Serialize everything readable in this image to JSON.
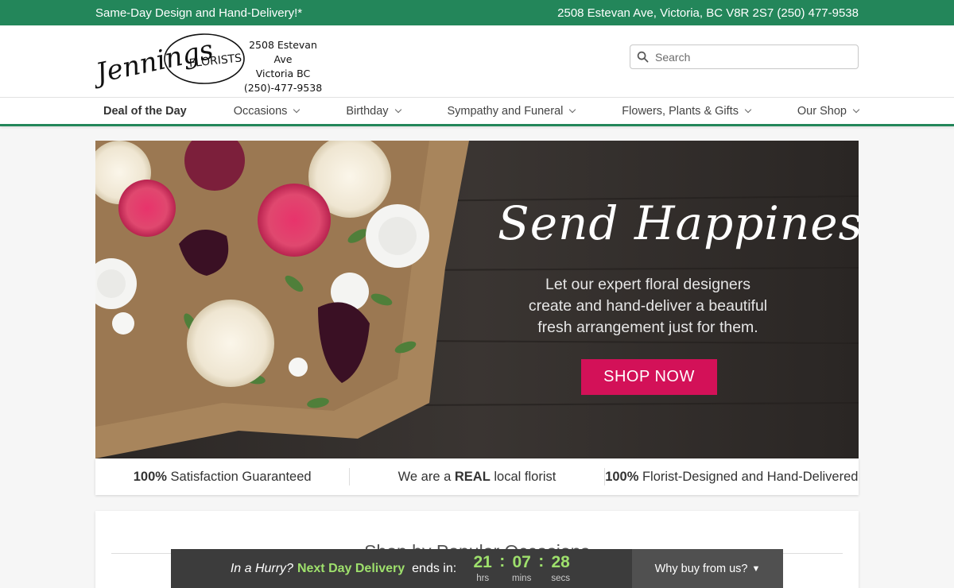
{
  "topbar": {
    "promo": "Same-Day Design and Hand-Delivery!*",
    "address_phone": "2508 Estevan Ave, Victoria, BC V8R 2S7 (250) 477-9538"
  },
  "header": {
    "logo_text": "Jennings",
    "logo_subtext": "FLORISTS",
    "address_line1": "2508 Estevan Ave",
    "address_line2": "Victoria BC",
    "address_line3": "(250)-477-9538",
    "search_placeholder": "Search"
  },
  "nav": {
    "items": [
      {
        "label": "Deal of the Day"
      },
      {
        "label": "Occasions"
      },
      {
        "label": "Birthday"
      },
      {
        "label": "Sympathy and Funeral"
      },
      {
        "label": "Flowers, Plants & Gifts"
      },
      {
        "label": "Our Shop"
      }
    ]
  },
  "hero": {
    "title": "Send Happiness",
    "text_line1": "Let our expert floral designers",
    "text_line2": "create and hand-deliver a beautiful",
    "text_line3": "fresh arrangement just for them.",
    "button_label": "SHOP NOW"
  },
  "trust": {
    "item1_bold": "100%",
    "item1_rest": " Satisfaction Guaranteed",
    "item2_pre": "We are a ",
    "item2_bold": "REAL",
    "item2_post": " local florist",
    "item3_bold": "100%",
    "item3_rest": " Florist-Designed and Hand-Delivered"
  },
  "occasions": {
    "title": "Shop by Popular Occasions"
  },
  "hurry": {
    "prefix": "In a Hurry?",
    "highlight": "Next Day Delivery",
    "suffix": "ends in:",
    "hours": "21",
    "minutes": "07",
    "seconds": "28",
    "hours_label": "hrs",
    "minutes_label": "mins",
    "seconds_label": "secs",
    "why_label": "Why buy from us?",
    "why_arrow": "▼"
  },
  "colors": {
    "brand_green": "#23865a",
    "accent_pink": "#d31158",
    "countdown_green": "#9ee06c"
  }
}
